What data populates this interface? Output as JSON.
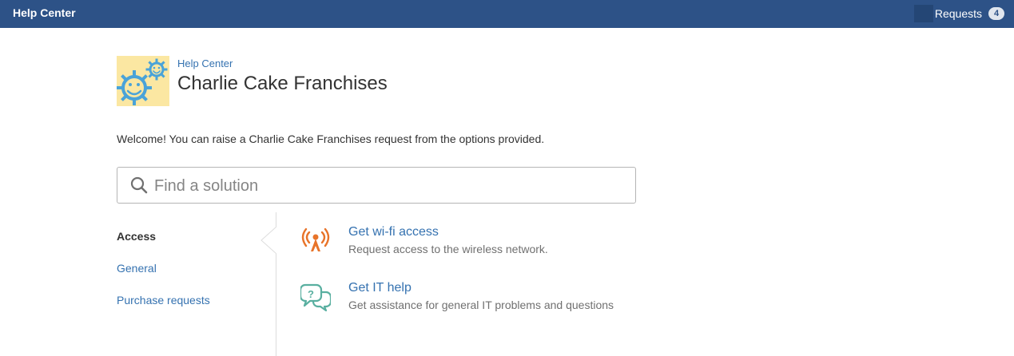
{
  "header": {
    "title": "Help Center",
    "requests_label": "Requests",
    "requests_count": "4",
    "bg_color": "#2d5287"
  },
  "portal": {
    "breadcrumb": "Help Center",
    "title": "Charlie Cake Franchises",
    "logo_icon": "gear-smiley-logo",
    "welcome": "Welcome! You can raise a Charlie Cake Franchises request from the options provided."
  },
  "search": {
    "placeholder": "Find a solution",
    "value": ""
  },
  "groups": [
    {
      "label": "Access",
      "active": true
    },
    {
      "label": "General",
      "active": false
    },
    {
      "label": "Purchase requests",
      "active": false
    }
  ],
  "request_types": [
    {
      "title": "Get wi-fi access",
      "description": "Request access to the wireless network.",
      "icon": "wifi-tower-icon",
      "icon_color": "#e8742a"
    },
    {
      "title": "Get IT help",
      "description": "Get assistance for general IT problems and questions",
      "icon": "chat-question-icon",
      "icon_color": "#59afa0"
    }
  ],
  "link_color": "#3572b0"
}
